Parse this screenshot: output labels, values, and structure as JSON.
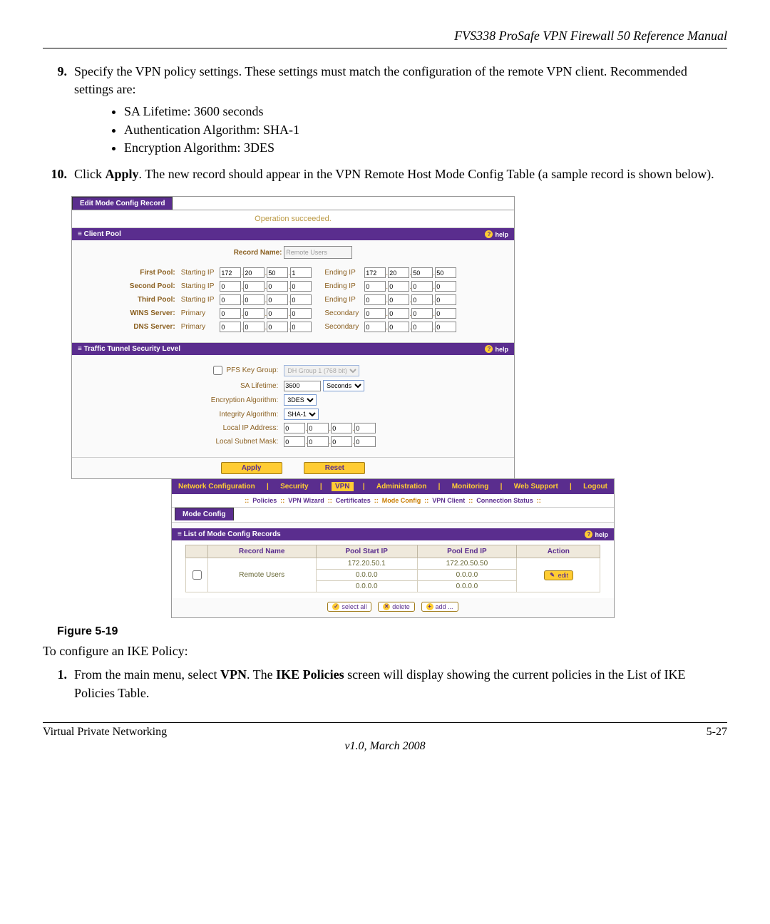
{
  "header": "FVS338 ProSafe VPN Firewall 50 Reference Manual",
  "step9": {
    "num": "9.",
    "text": "Specify the VPN policy settings. These settings must match the configuration of the remote VPN client. Recommended settings are:",
    "bullets": [
      "SA Lifetime: 3600 seconds",
      "Authentication Algorithm: SHA-1",
      "Encryption Algorithm: 3DES"
    ]
  },
  "step10": {
    "num": "10.",
    "pre": "Click ",
    "bold": "Apply",
    "post": ". The new record should appear in the VPN Remote Host Mode Config Table (a sample record is shown below)."
  },
  "panel1": {
    "tab": "Edit Mode Config Record",
    "op": "Operation succeeded.",
    "sec1": "Client Pool",
    "help": "help",
    "recname_lab": "Record Name:",
    "recname_val": "Remote Users",
    "rows": [
      {
        "lab": "First Pool:",
        "s": "Starting IP",
        "sip": [
          "172",
          "20",
          "50",
          "1"
        ],
        "e": "Ending IP",
        "eip": [
          "172",
          "20",
          "50",
          "50"
        ]
      },
      {
        "lab": "Second Pool:",
        "s": "Starting IP",
        "sip": [
          "0",
          "0",
          "0",
          "0"
        ],
        "e": "Ending IP",
        "eip": [
          "0",
          "0",
          "0",
          "0"
        ]
      },
      {
        "lab": "Third Pool:",
        "s": "Starting IP",
        "sip": [
          "0",
          "0",
          "0",
          "0"
        ],
        "e": "Ending IP",
        "eip": [
          "0",
          "0",
          "0",
          "0"
        ]
      },
      {
        "lab": "WINS Server:",
        "s": "Primary",
        "sip": [
          "0",
          "0",
          "0",
          "0"
        ],
        "e": "Secondary",
        "eip": [
          "0",
          "0",
          "0",
          "0"
        ]
      },
      {
        "lab": "DNS Server:",
        "s": "Primary",
        "sip": [
          "0",
          "0",
          "0",
          "0"
        ],
        "e": "Secondary",
        "eip": [
          "0",
          "0",
          "0",
          "0"
        ]
      }
    ],
    "sec2": "Traffic Tunnel Security Level",
    "pfs_lab": "PFS Key Group:",
    "pfs_val": "DH Group 1 (768 bit)",
    "sa_lab": "SA Lifetime:",
    "sa_val": "3600",
    "sa_unit": "Seconds",
    "enc_lab": "Encryption Algorithm:",
    "enc_val": "3DES",
    "int_lab": "Integrity Algorithm:",
    "int_val": "SHA-1",
    "lip_lab": "Local IP Address:",
    "lip": [
      "0",
      "0",
      "0",
      "0"
    ],
    "lsm_lab": "Local Subnet Mask:",
    "lsm": [
      "0",
      "0",
      "0",
      "0"
    ],
    "apply": "Apply",
    "reset": "Reset"
  },
  "panel2": {
    "nav": [
      "Network Configuration",
      "Security",
      "VPN",
      "Administration",
      "Monitoring",
      "Web Support",
      "Logout"
    ],
    "nav_active": "VPN",
    "subnav": [
      "Policies",
      "VPN Wizard",
      "Certificates",
      "Mode Config",
      "VPN Client",
      "Connection Status"
    ],
    "subnav_active": "Mode Config",
    "tab": "Mode Config",
    "sec": "List of Mode Config Records",
    "cols": [
      "Record Name",
      "Pool Start IP",
      "Pool End IP",
      "Action"
    ],
    "row": {
      "name": "Remote Users",
      "start": [
        "172.20.50.1",
        "0.0.0.0",
        "0.0.0.0"
      ],
      "end": [
        "172.20.50.50",
        "0.0.0.0",
        "0.0.0.0"
      ],
      "edit": "edit"
    },
    "btns": {
      "selectall": "select all",
      "delete": "delete",
      "add": "add ..."
    }
  },
  "caption": "Figure 5-19",
  "after1": "To configure an IKE Policy:",
  "step1": {
    "num": "1.",
    "p1": "From the main menu, select ",
    "b1": "VPN",
    "p2": ". The ",
    "b2": "IKE Policies",
    "p3": " screen will display showing the current policies in the List of IKE Policies Table."
  },
  "footer": {
    "left": "Virtual Private Networking",
    "right": "5-27",
    "sub": "v1.0, March 2008"
  }
}
